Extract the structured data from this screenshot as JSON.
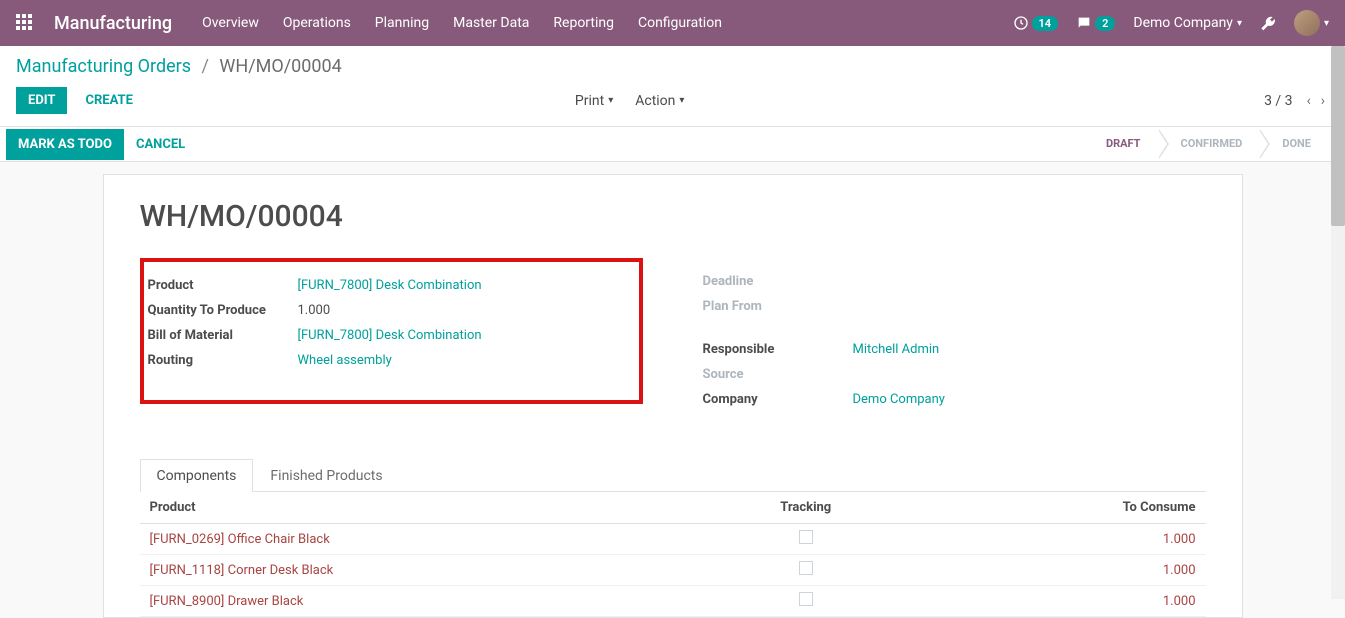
{
  "navbar": {
    "brand": "Manufacturing",
    "menu": [
      "Overview",
      "Operations",
      "Planning",
      "Master Data",
      "Reporting",
      "Configuration"
    ],
    "activity_badge": "14",
    "messages_badge": "2",
    "company": "Demo Company"
  },
  "breadcrumb": {
    "root": "Manufacturing Orders",
    "current": "WH/MO/00004"
  },
  "control_panel": {
    "edit": "EDIT",
    "create": "CREATE",
    "print": "Print",
    "action": "Action",
    "pager": "3 / 3"
  },
  "status_bar": {
    "mark_todo": "MARK AS TODO",
    "cancel": "CANCEL",
    "steps": [
      "DRAFT",
      "CONFIRMED",
      "DONE"
    ],
    "active_index": 0
  },
  "record": {
    "title": "WH/MO/00004",
    "left_fields": [
      {
        "label": "Product",
        "value": "[FURN_7800] Desk Combination",
        "link": true
      },
      {
        "label": "Quantity To Produce",
        "value": "1.000",
        "link": false
      },
      {
        "label": "Bill of Material",
        "value": "[FURN_7800] Desk Combination",
        "link": true
      },
      {
        "label": "Routing",
        "value": "Wheel assembly",
        "link": true
      }
    ],
    "right_fields": [
      {
        "label": "Deadline",
        "value": "",
        "muted": true,
        "link": false
      },
      {
        "label": "Plan From",
        "value": "",
        "muted": true,
        "link": false
      },
      {
        "label": "Responsible",
        "value": "Mitchell Admin",
        "muted": false,
        "link": true
      },
      {
        "label": "Source",
        "value": "",
        "muted": true,
        "link": false
      },
      {
        "label": "Company",
        "value": "Demo Company",
        "muted": false,
        "link": true
      }
    ]
  },
  "tabs": {
    "items": [
      "Components",
      "Finished Products"
    ],
    "active_index": 0
  },
  "table": {
    "headers": {
      "product": "Product",
      "tracking": "Tracking",
      "to_consume": "To Consume"
    },
    "rows": [
      {
        "product": "[FURN_0269] Office Chair Black",
        "tracking": false,
        "to_consume": "1.000"
      },
      {
        "product": "[FURN_1118] Corner Desk Black",
        "tracking": false,
        "to_consume": "1.000"
      },
      {
        "product": "[FURN_8900] Drawer Black",
        "tracking": false,
        "to_consume": "1.000"
      }
    ]
  }
}
